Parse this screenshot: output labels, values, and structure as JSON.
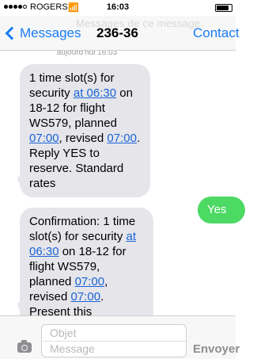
{
  "status_bar": {
    "carrier": "ROGERS",
    "time": "16:03",
    "wifi_icon": "wifi-icon",
    "signal_bars": 4,
    "battery_level": 0.85
  },
  "nav": {
    "back_label": "Messages",
    "title": "236-36",
    "contact_label": "Contact",
    "ghost_text": "Messages de ce message."
  },
  "timestamp": "aujourd'hui 16:03",
  "messages": [
    {
      "sender": "received",
      "parts": [
        "1 time slot(s) for security ",
        "at 06:30",
        " on 18-12 for flight WS579, planned ",
        "07:00",
        ", revised ",
        "07:00",
        ". Reply YES to reserve. Standard rates"
      ]
    },
    {
      "sender": "sent",
      "text": "Yes"
    },
    {
      "sender": "received",
      "parts": [
        "Confirmation: 1 time slot(s) for security ",
        "at 06:30",
        " on 18-12 for flight WS579, planned ",
        "07:00",
        ", revised ",
        "07:00",
        ". Present this message."
      ]
    }
  ],
  "input": {
    "subject_placeholder": "Objet",
    "message_placeholder": "Message",
    "send_label": "Envoyer",
    "camera_icon": "camera-icon"
  },
  "colors": {
    "accent": "#1a7cf6",
    "sent_bubble": "#4cd964",
    "received_bubble": "#e5e5ea",
    "link": "#1a64d6"
  }
}
